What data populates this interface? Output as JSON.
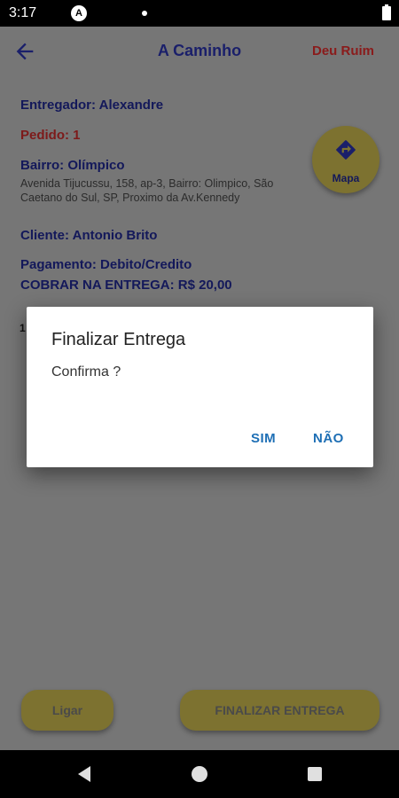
{
  "status_bar": {
    "time": "3:17",
    "notification_icon": "A"
  },
  "app_bar": {
    "title": "A Caminho",
    "action": "Deu Ruim"
  },
  "delivery": {
    "entregador": "Entregador: Alexandre",
    "pedido": "Pedido: 1",
    "bairro": "Bairro: Olímpico",
    "endereco": "Avenida Tijucussu, 158, ap-3, Bairro: Olimpico, São Caetano do Sul, SP, Proximo da Av.Kennedy",
    "cliente": "Cliente:  Antonio Brito",
    "pagamento": "Pagamento: Debito/Credito",
    "cobrar": "COBRAR NA ENTREGA: R$ 20,00",
    "partial_text": "1"
  },
  "map_button": {
    "label": "Mapa",
    "icon": "directions-icon"
  },
  "bottom_buttons": {
    "ligar": "Ligar",
    "finalizar": "FINALIZAR ENTREGA"
  },
  "dialog": {
    "title": "Finalizar Entrega",
    "message": "Confirma ?",
    "positive": "SIM",
    "negative": "NÃO"
  },
  "colors": {
    "primary": "#1a1f6a",
    "danger": "#8a1b1b",
    "accent": "#f2de5b",
    "dialog_button": "#1e6fb5"
  }
}
